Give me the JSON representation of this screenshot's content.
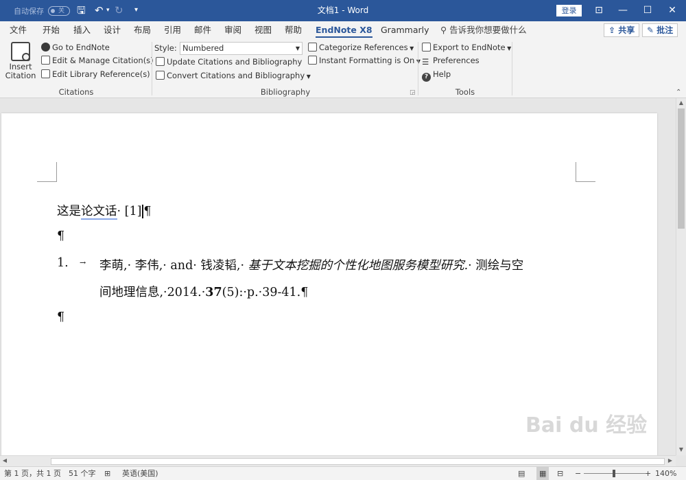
{
  "titlebar": {
    "autosave_label": "自动保存",
    "autosave_state": "关",
    "doc_title": "文档1 - Word",
    "login_label": "登录"
  },
  "menu": {
    "tabs": [
      "文件",
      "开始",
      "插入",
      "设计",
      "布局",
      "引用",
      "邮件",
      "审阅",
      "视图",
      "帮助",
      "EndNote X8",
      "Grammarly"
    ],
    "active_tab": "EndNote X8",
    "tell_me": "告诉我你想要做什么",
    "share": "共享",
    "comments": "批注"
  },
  "ribbon": {
    "citations": {
      "insert_citation": "Insert Citation",
      "go_to_endnote": "Go to EndNote",
      "edit_manage": "Edit & Manage Citation(s)",
      "edit_library": "Edit Library Reference(s)",
      "group_label": "Citations"
    },
    "bibliography": {
      "style_label": "Style:",
      "style_value": "Numbered",
      "update": "Update Citations and Bibliography",
      "convert": "Convert Citations and Bibliography",
      "categorize": "Categorize References",
      "instant_formatting": "Instant Formatting is On",
      "group_label": "Bibliography"
    },
    "tools": {
      "export": "Export to EndNote",
      "preferences": "Preferences",
      "help": "Help",
      "group_label": "Tools"
    }
  },
  "document": {
    "line1_a": "这是",
    "line1_b": "论文话",
    "line1_c": "· [1]",
    "pilcrow": "¶",
    "ref_number": "1.",
    "ref_tab": "→",
    "ref_authors": "李萌,· 李伟,· and· 钱凌韬,· ",
    "ref_title": "基于文本挖掘的个性化地图服务模型研究.",
    "ref_journal_a": "· 测绘与空",
    "ref_journal_b": "间地理信息,·2014.·",
    "ref_volume": "37",
    "ref_rest": "(5):·p.·39-41.",
    "ref_end": "¶"
  },
  "statusbar": {
    "page": "第 1 页，共 1 页",
    "words": "51 个字",
    "lang": "英语(美国)",
    "zoom": "140%"
  },
  "watermark": "Bai du 经验"
}
